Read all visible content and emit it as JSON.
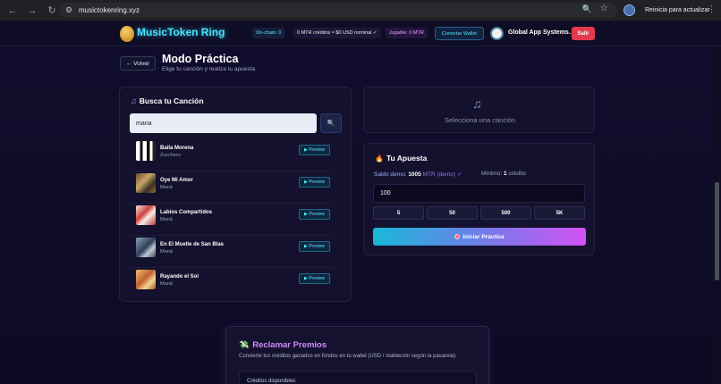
{
  "browser": {
    "url": "musictokenring.xyz",
    "update_label": "Reinicia para actualizar"
  },
  "header": {
    "logo_text": "MusicToken Ring",
    "onchain": "On-chain: 0",
    "credits": "0 MTR créditos ≈ $0 USD nominal ✓",
    "jugable": "Jugable: 0 MTR",
    "connect_label": "Conectar Wallet",
    "username": "Global App Systems…",
    "salir_label": "Salir"
  },
  "page": {
    "back_label": "← Volver",
    "title": "Modo Práctica",
    "subtitle": "Elige tu canción y realiza tu apuesta"
  },
  "search": {
    "title": "Busca tu Canción",
    "query": "mana",
    "songs": [
      {
        "title": "Baila Morena",
        "artist": "Zucchero",
        "preview": "▶ Preview"
      },
      {
        "title": "Oye Mi Amor",
        "artist": "Maná",
        "preview": "▶ Preview"
      },
      {
        "title": "Labios Compartidos",
        "artist": "Maná",
        "preview": "▶ Preview"
      },
      {
        "title": "En El Muelle de San Blas",
        "artist": "Maná",
        "preview": "▶ Preview"
      },
      {
        "title": "Rayando el Sol",
        "artist": "Maná",
        "preview": "▶ Preview"
      }
    ]
  },
  "selection": {
    "text": "Selecciona una canción"
  },
  "bet": {
    "title": "Tu Apuesta",
    "saldo_label": "Saldo demo:",
    "saldo_value": "1005",
    "saldo_unit": "MTR (demo) ✓",
    "minimo_label": "Mínimo:",
    "minimo_value": "1",
    "minimo_unit": "crédito",
    "amount": "100",
    "chips": [
      "5",
      "50",
      "500",
      "5K"
    ],
    "start_label": "Iniciar Práctica"
  },
  "claim": {
    "title": "Reclamar Premios",
    "description": "Convierte tus créditos ganados en fondos en tu wallet (USD / stablecoin según la pasarela).",
    "available_label": "Créditos disponibles:"
  },
  "colors": {
    "accent_cyan": "#48e4ff",
    "accent_purple": "#d08cff",
    "danger": "#e53a4e",
    "background": "#0b0a1f"
  }
}
